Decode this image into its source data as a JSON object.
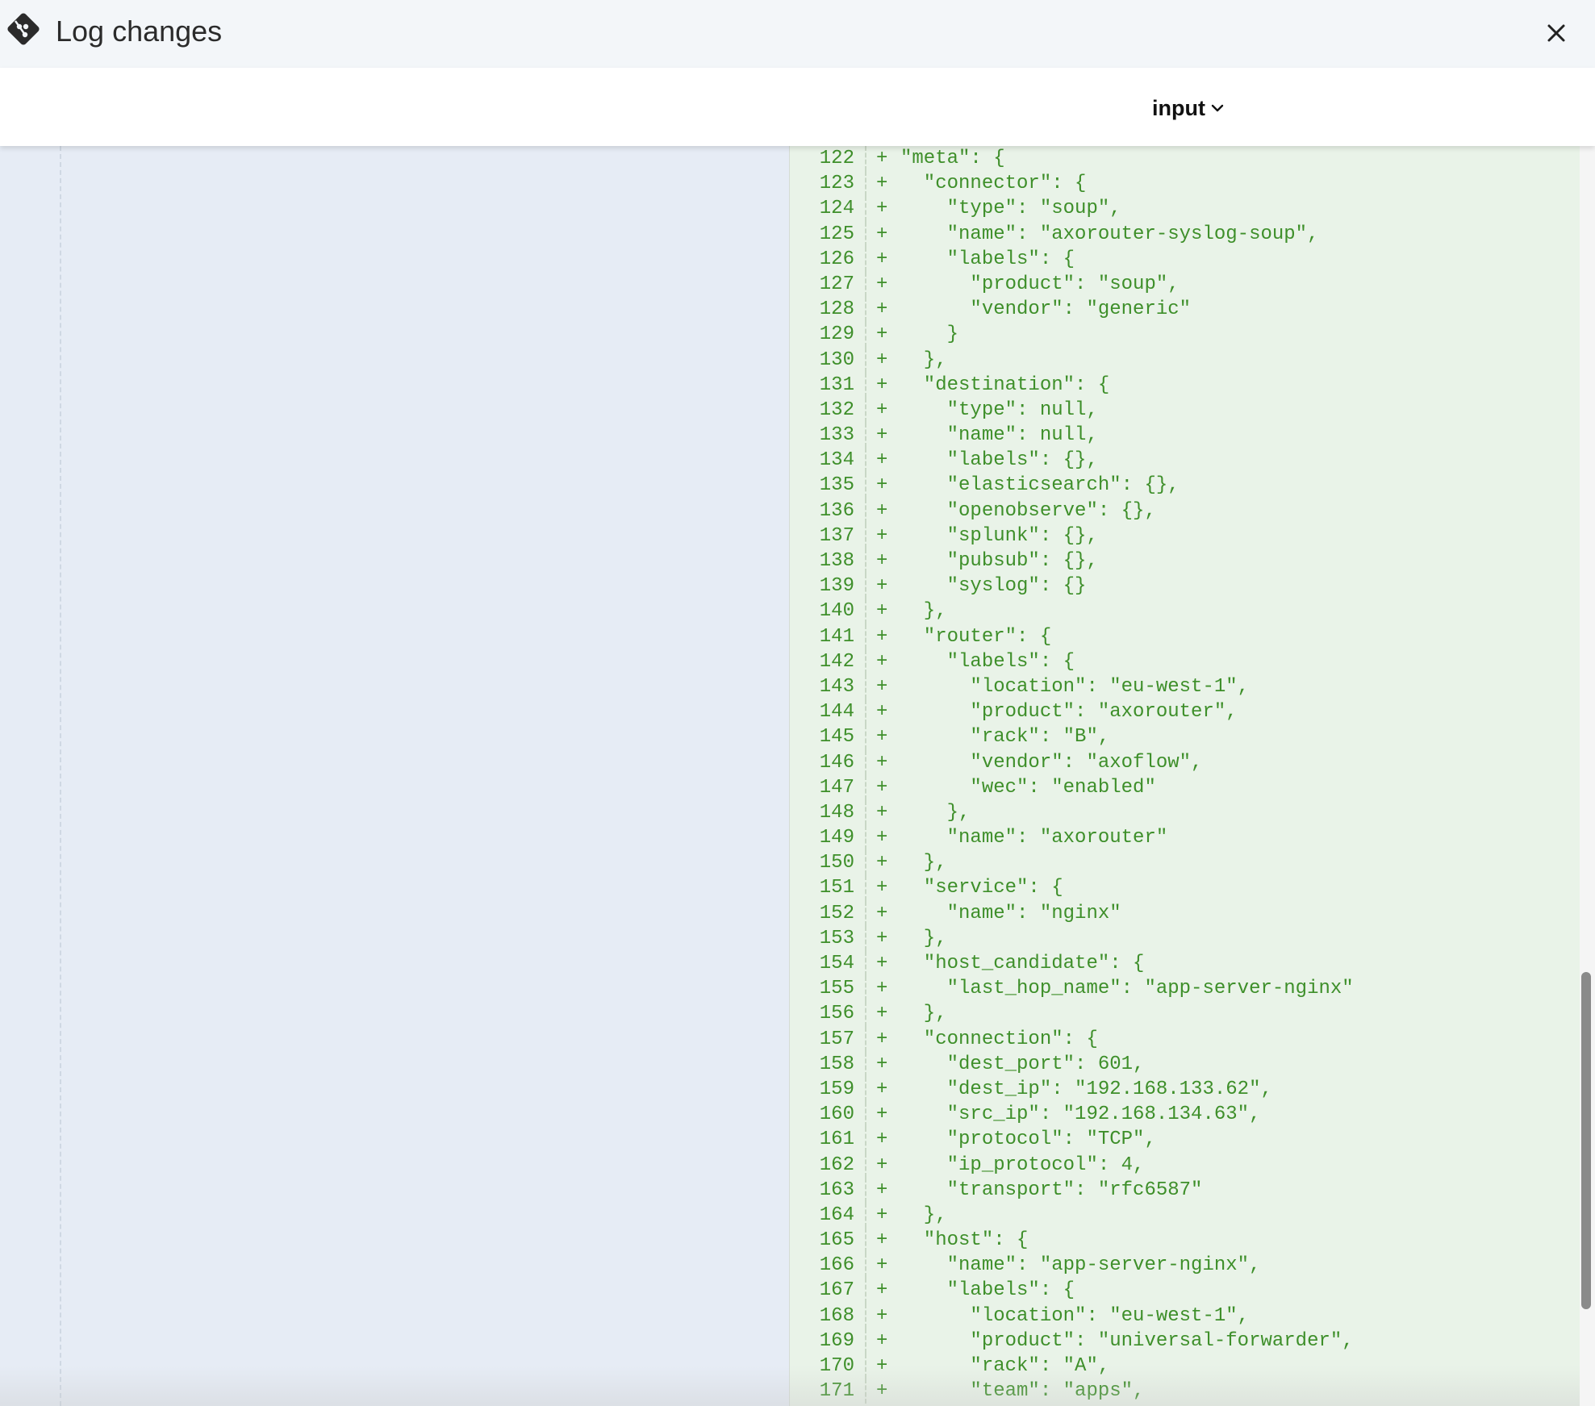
{
  "header": {
    "title": "Log changes",
    "icon": "git-icon",
    "close_icon": "close-icon"
  },
  "toolbar": {
    "dropdown_label": "input",
    "dropdown_icon": "chevron-down-icon"
  },
  "diff": {
    "lines": [
      {
        "n": "122",
        "m": "+",
        "t": "\"meta\": {"
      },
      {
        "n": "123",
        "m": "+",
        "t": "  \"connector\": {"
      },
      {
        "n": "124",
        "m": "+",
        "t": "    \"type\": \"soup\","
      },
      {
        "n": "125",
        "m": "+",
        "t": "    \"name\": \"axorouter-syslog-soup\","
      },
      {
        "n": "126",
        "m": "+",
        "t": "    \"labels\": {"
      },
      {
        "n": "127",
        "m": "+",
        "t": "      \"product\": \"soup\","
      },
      {
        "n": "128",
        "m": "+",
        "t": "      \"vendor\": \"generic\""
      },
      {
        "n": "129",
        "m": "+",
        "t": "    }"
      },
      {
        "n": "130",
        "m": "+",
        "t": "  },"
      },
      {
        "n": "131",
        "m": "+",
        "t": "  \"destination\": {"
      },
      {
        "n": "132",
        "m": "+",
        "t": "    \"type\": null,"
      },
      {
        "n": "133",
        "m": "+",
        "t": "    \"name\": null,"
      },
      {
        "n": "134",
        "m": "+",
        "t": "    \"labels\": {},"
      },
      {
        "n": "135",
        "m": "+",
        "t": "    \"elasticsearch\": {},"
      },
      {
        "n": "136",
        "m": "+",
        "t": "    \"openobserve\": {},"
      },
      {
        "n": "137",
        "m": "+",
        "t": "    \"splunk\": {},"
      },
      {
        "n": "138",
        "m": "+",
        "t": "    \"pubsub\": {},"
      },
      {
        "n": "139",
        "m": "+",
        "t": "    \"syslog\": {}"
      },
      {
        "n": "140",
        "m": "+",
        "t": "  },"
      },
      {
        "n": "141",
        "m": "+",
        "t": "  \"router\": {"
      },
      {
        "n": "142",
        "m": "+",
        "t": "    \"labels\": {"
      },
      {
        "n": "143",
        "m": "+",
        "t": "      \"location\": \"eu-west-1\","
      },
      {
        "n": "144",
        "m": "+",
        "t": "      \"product\": \"axorouter\","
      },
      {
        "n": "145",
        "m": "+",
        "t": "      \"rack\": \"B\","
      },
      {
        "n": "146",
        "m": "+",
        "t": "      \"vendor\": \"axoflow\","
      },
      {
        "n": "147",
        "m": "+",
        "t": "      \"wec\": \"enabled\""
      },
      {
        "n": "148",
        "m": "+",
        "t": "    },"
      },
      {
        "n": "149",
        "m": "+",
        "t": "    \"name\": \"axorouter\""
      },
      {
        "n": "150",
        "m": "+",
        "t": "  },"
      },
      {
        "n": "151",
        "m": "+",
        "t": "  \"service\": {"
      },
      {
        "n": "152",
        "m": "+",
        "t": "    \"name\": \"nginx\""
      },
      {
        "n": "153",
        "m": "+",
        "t": "  },"
      },
      {
        "n": "154",
        "m": "+",
        "t": "  \"host_candidate\": {"
      },
      {
        "n": "155",
        "m": "+",
        "t": "    \"last_hop_name\": \"app-server-nginx\""
      },
      {
        "n": "156",
        "m": "+",
        "t": "  },"
      },
      {
        "n": "157",
        "m": "+",
        "t": "  \"connection\": {"
      },
      {
        "n": "158",
        "m": "+",
        "t": "    \"dest_port\": 601,"
      },
      {
        "n": "159",
        "m": "+",
        "t": "    \"dest_ip\": \"192.168.133.62\","
      },
      {
        "n": "160",
        "m": "+",
        "t": "    \"src_ip\": \"192.168.134.63\","
      },
      {
        "n": "161",
        "m": "+",
        "t": "    \"protocol\": \"TCP\","
      },
      {
        "n": "162",
        "m": "+",
        "t": "    \"ip_protocol\": 4,"
      },
      {
        "n": "163",
        "m": "+",
        "t": "    \"transport\": \"rfc6587\""
      },
      {
        "n": "164",
        "m": "+",
        "t": "  },"
      },
      {
        "n": "165",
        "m": "+",
        "t": "  \"host\": {"
      },
      {
        "n": "166",
        "m": "+",
        "t": "    \"name\": \"app-server-nginx\","
      },
      {
        "n": "167",
        "m": "+",
        "t": "    \"labels\": {"
      },
      {
        "n": "168",
        "m": "+",
        "t": "      \"location\": \"eu-west-1\","
      },
      {
        "n": "169",
        "m": "+",
        "t": "      \"product\": \"universal-forwarder\","
      },
      {
        "n": "170",
        "m": "+",
        "t": "      \"rack\": \"A\","
      },
      {
        "n": "171",
        "m": "+",
        "t": "      \"team\": \"apps\","
      }
    ]
  }
}
